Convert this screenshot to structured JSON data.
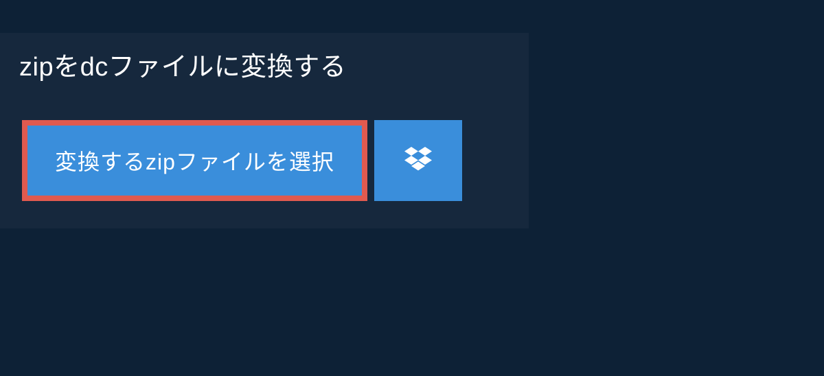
{
  "title": "zipをdcファイルに変換する",
  "buttons": {
    "select_file": "変換するzipファイルを選択"
  },
  "colors": {
    "background": "#0d2136",
    "panel": "#16283d",
    "button": "#3a8edb",
    "highlight_border": "#e05a4f",
    "text": "#ffffff"
  }
}
